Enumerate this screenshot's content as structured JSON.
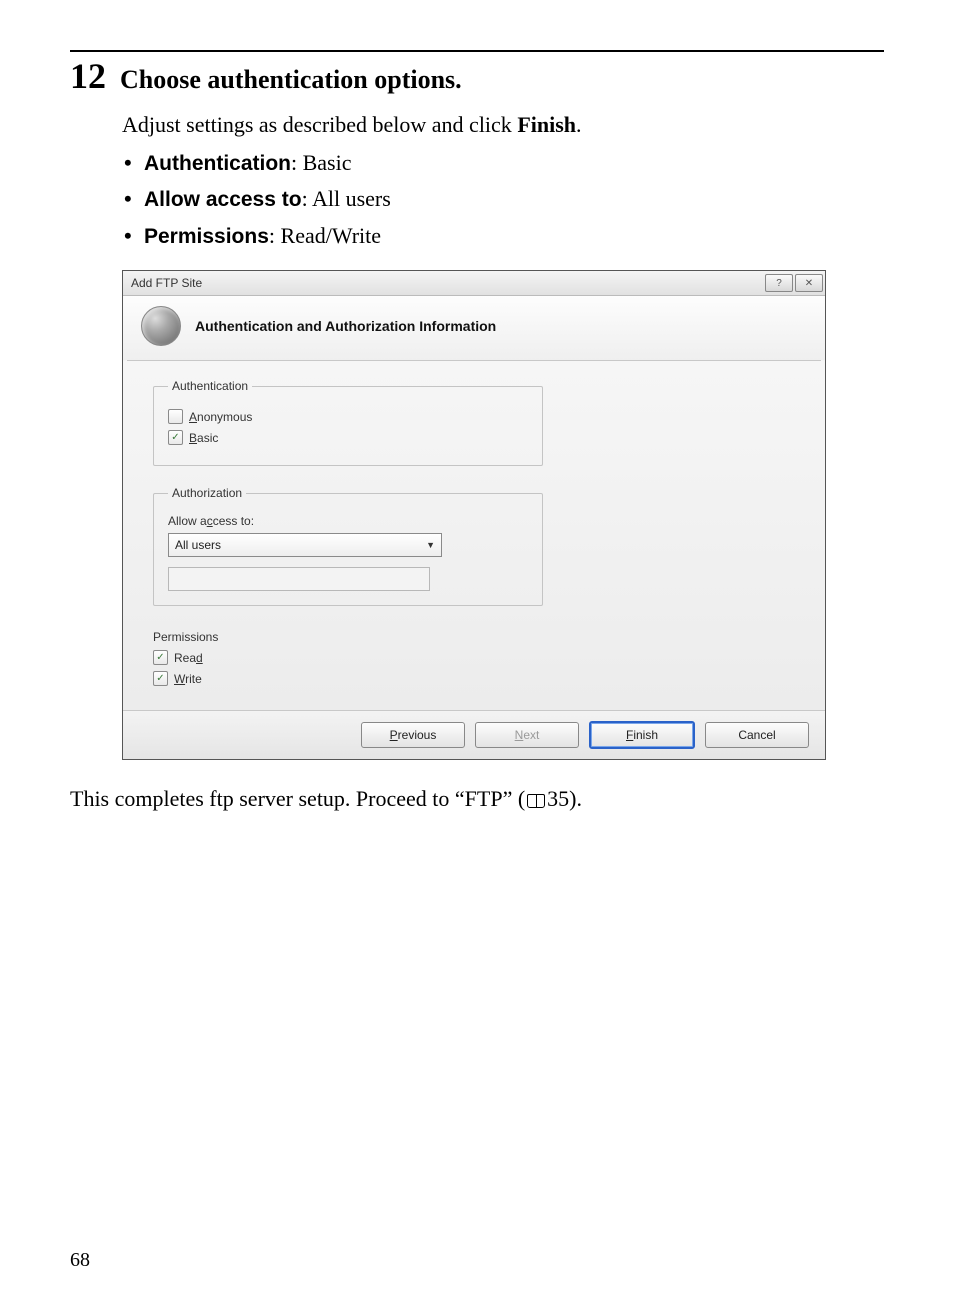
{
  "step": {
    "number": "12",
    "title": "Choose authentication options."
  },
  "intro": {
    "text_before_bold": "Adjust settings as described below and click ",
    "bold_word": "Finish",
    "text_after_bold": "."
  },
  "bullets": [
    {
      "label": "Authentication",
      "value": ": Basic"
    },
    {
      "label": "Allow access to",
      "value": ": All users"
    },
    {
      "label": "Permissions",
      "value": ": Read/Write"
    }
  ],
  "dialog": {
    "title": "Add FTP Site",
    "header": "Authentication and Authorization Information",
    "help_symbol": "?",
    "close_symbol": "✕",
    "auth": {
      "legend": "Authentication",
      "anonymous": {
        "label_pre": "A",
        "label_rest": "nonymous",
        "checked": false
      },
      "basic": {
        "label_pre": "B",
        "label_rest": "asic",
        "checked": true
      }
    },
    "authorization": {
      "legend": "Authorization",
      "allow_label_pre": "Allow a",
      "allow_label_under": "c",
      "allow_label_post": "cess to:",
      "selected": "All users"
    },
    "permissions": {
      "legend": "Permissions",
      "read": {
        "label_pre": "Rea",
        "label_under": "d",
        "checked": true
      },
      "write": {
        "label_under": "W",
        "label_rest": "rite",
        "checked": true
      }
    },
    "buttons": {
      "previous": {
        "under": "P",
        "rest": "revious"
      },
      "next": {
        "under": "N",
        "rest": "ext"
      },
      "finish": {
        "under": "F",
        "rest": "inish"
      },
      "cancel": "Cancel"
    }
  },
  "closing": {
    "text": "This completes ftp server setup. Proceed to “FTP” (",
    "page_ref": "35).",
    "separator": ""
  },
  "page_number": "68"
}
